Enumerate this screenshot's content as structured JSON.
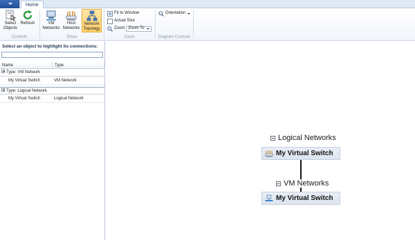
{
  "tabs": {
    "home": "Home"
  },
  "ribbon": {
    "controls": {
      "label": "Controls",
      "select_objects": "Select Objects",
      "refresh": "Refresh"
    },
    "show": {
      "label": "Show",
      "vm_networks": "VM Networks",
      "host_networks": "Host Networks",
      "network_topology": "Network Topology"
    },
    "zoom": {
      "label": "Zoom",
      "fit_to_window": "Fit to Window",
      "actual_size": "Actual Size",
      "zoom_label": "Zoom",
      "zoom_value": "Zoom To"
    },
    "diagram_controls": {
      "label": "Diagram Controls",
      "orientation": "Orientation"
    }
  },
  "left_panel": {
    "title": "Select an object to highlight its connections:",
    "search_value": "",
    "columns": {
      "name": "Name",
      "type": "Type"
    },
    "groups": [
      {
        "label": "Type:  VM Network",
        "rows": [
          {
            "name": "My Virtual Switch",
            "type": "VM Network"
          }
        ]
      },
      {
        "label": "Type:  Logical Network",
        "rows": [
          {
            "name": "My Virtual Switch",
            "type": "Logical Network"
          }
        ]
      }
    ]
  },
  "diagram": {
    "logical_networks": {
      "title": "Logical Networks",
      "node": "My Virtual Switch"
    },
    "vm_networks": {
      "title": "VM Networks",
      "node": "My Virtual Switch"
    }
  },
  "colors": {
    "accent": "#1f4f97",
    "active_button": "#ffcf6a",
    "node_fill": "#e3eaf2"
  },
  "icons": {
    "select_objects": "select-objects-icon",
    "refresh": "refresh-icon",
    "vm_networks": "vm-networks-icon",
    "host_networks": "host-networks-icon",
    "network_topology": "network-topology-icon",
    "fit_to_window": "fit-to-window-icon",
    "actual_size": "actual-size-icon",
    "zoom": "magnifier-icon",
    "orientation": "magnifier-icon"
  }
}
